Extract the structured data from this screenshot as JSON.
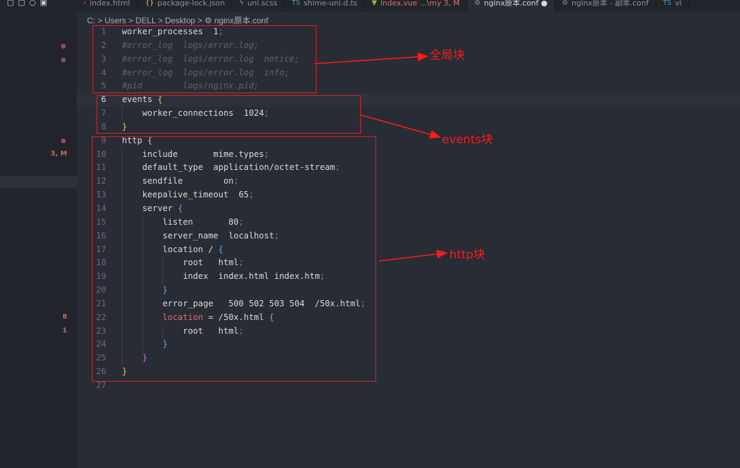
{
  "tabs": [
    {
      "label": "index.html",
      "icon": "html-icon",
      "color": "#8b919c"
    },
    {
      "label": "package-lock.json",
      "icon": "json-icon",
      "color": "#8b919c"
    },
    {
      "label": "uni.scss",
      "icon": "sass-icon",
      "color": "#8b919c"
    },
    {
      "label": "shime-uni.d.ts",
      "icon": "ts-icon",
      "color": "#8b919c"
    },
    {
      "label": "index.vue ...\\my 3, M",
      "icon": "vue-icon",
      "color": "#e06c75"
    },
    {
      "label": "nginx原本.conf ●",
      "icon": "gear-icon",
      "color": "#d7dae0",
      "active": true
    },
    {
      "label": "nginx原本 - 副本.conf",
      "icon": "gear-icon",
      "color": "#8b919c"
    },
    {
      "label": "vi",
      "icon": "ts-icon",
      "color": "#8b919c"
    }
  ],
  "breadcrumb": "C: > Users > DELL > Desktop > ⚙ nginx原本.conf",
  "sidebar_markers": [
    {
      "text": "3, M"
    },
    {
      "text": "8"
    },
    {
      "text": "1"
    }
  ],
  "annotations": {
    "global": "全局块",
    "events": "events块",
    "http": "http块"
  },
  "code": [
    [
      [
        "k",
        "worker_processes  1"
      ],
      [
        "p",
        ";"
      ]
    ],
    [
      [
        "cm",
        "#error_log  logs/error.log;"
      ]
    ],
    [
      [
        "cm",
        "#error_log  logs/error.log  notice;"
      ]
    ],
    [
      [
        "cm",
        "#error_log  logs/error.log  info;"
      ]
    ],
    [
      [
        "cm",
        "#pid        logs/nginx.pid;"
      ]
    ],
    [
      [
        "k",
        "events "
      ],
      [
        "y",
        "{"
      ]
    ],
    [
      [
        "k",
        "    worker_connections  1024"
      ],
      [
        "p",
        ";"
      ]
    ],
    [
      [
        "y",
        "}"
      ]
    ],
    [
      [
        "k",
        "http "
      ],
      [
        "y",
        "{"
      ]
    ],
    [
      [
        "k",
        "    include       mime.types"
      ],
      [
        "p",
        ";"
      ]
    ],
    [
      [
        "k",
        "    default_type  application/octet-stream"
      ],
      [
        "p",
        ";"
      ]
    ],
    [
      [
        "k",
        "    sendfile        on"
      ],
      [
        "p",
        ";"
      ]
    ],
    [
      [
        "k",
        "    keepalive_timeout  65"
      ],
      [
        "p",
        ";"
      ]
    ],
    [
      [
        "k",
        "    server "
      ],
      [
        "pu",
        "{"
      ]
    ],
    [
      [
        "k",
        "        listen       80"
      ],
      [
        "p",
        ";"
      ]
    ],
    [
      [
        "k",
        "        server_name  localhost"
      ],
      [
        "p",
        ";"
      ]
    ],
    [
      [
        "k",
        "        location / "
      ],
      [
        "b",
        "{"
      ]
    ],
    [
      [
        "k",
        "            root   html"
      ],
      [
        "p",
        ";"
      ]
    ],
    [
      [
        "k",
        "            index  index.html index.htm"
      ],
      [
        "p",
        ";"
      ]
    ],
    [
      [
        "b",
        "        }"
      ]
    ],
    [
      [
        "k",
        "        error_page   500 502 503 504  /50x.html"
      ],
      [
        "p",
        ";"
      ]
    ],
    [
      [
        "r",
        "        location"
      ],
      [
        "k",
        " = /50x.html "
      ],
      [
        "b",
        "{"
      ]
    ],
    [
      [
        "k",
        "            root   html"
      ],
      [
        "p",
        ";"
      ]
    ],
    [
      [
        "b",
        "        }"
      ]
    ],
    [
      [
        "pu",
        "    }"
      ]
    ],
    [
      [
        "y",
        "}"
      ]
    ],
    []
  ]
}
